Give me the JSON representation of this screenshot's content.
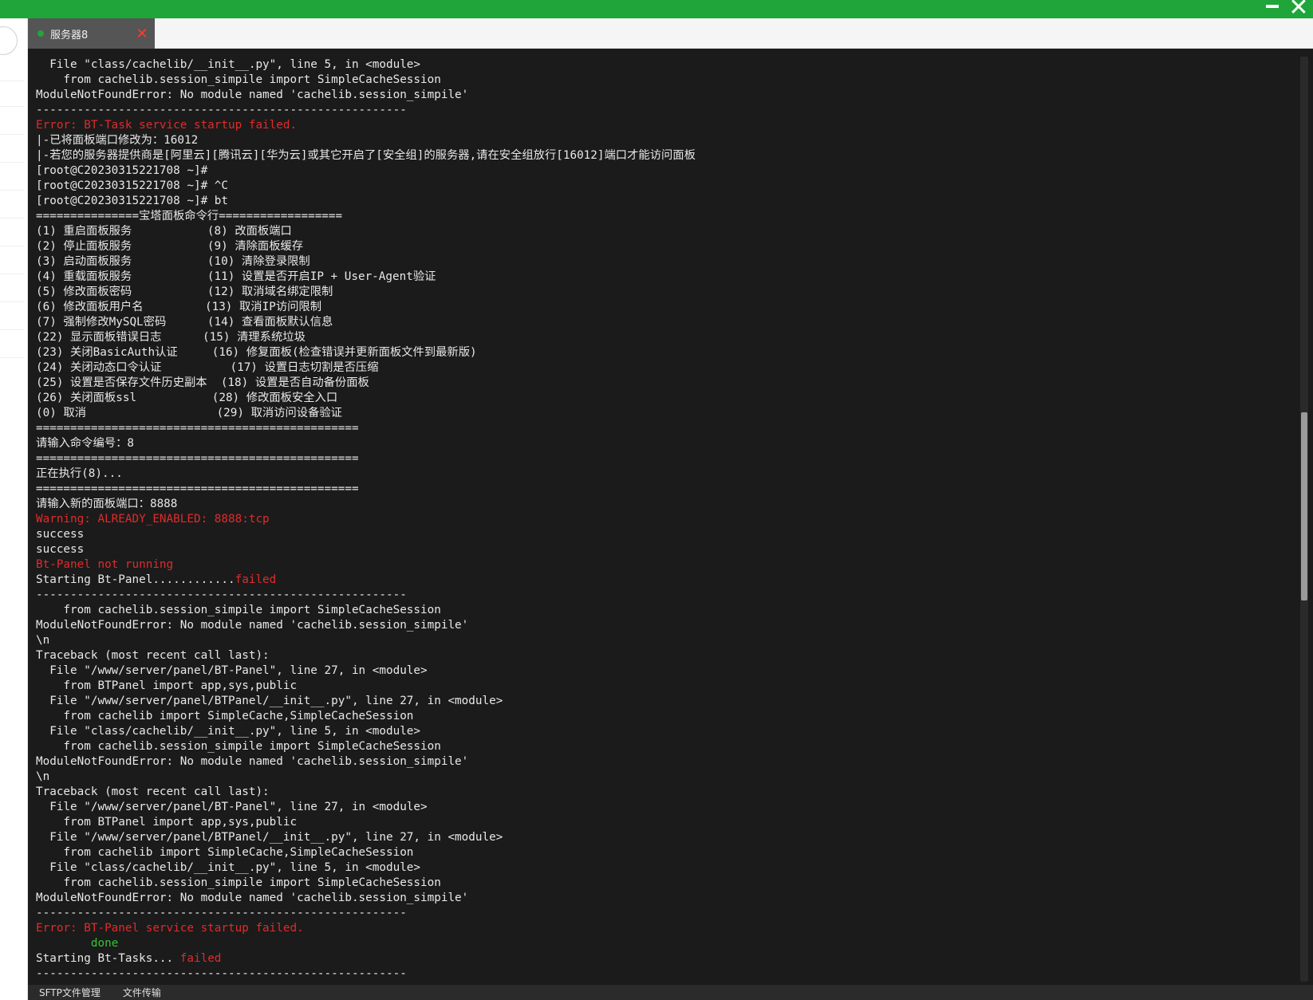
{
  "window": {
    "minimize_icon": "minimize-icon",
    "close_icon": "close-icon",
    "accent": "#20a53a"
  },
  "tabs": [
    {
      "label": "服务器8",
      "status_color": "#20a53a",
      "close_glyph": "✕"
    }
  ],
  "bottom_tabs": [
    {
      "label": "SFTP文件管理"
    },
    {
      "label": "文件传输"
    }
  ],
  "terminal": {
    "background": "#1b1b1b",
    "lines": [
      {
        "segments": [
          {
            "text": "  File \"class/cachelib/__init__.py\", line 5, in <module>"
          }
        ]
      },
      {
        "segments": [
          {
            "text": "    from cachelib.session_simpile import SimpleCacheSession"
          }
        ]
      },
      {
        "segments": [
          {
            "text": "ModuleNotFoundError: No module named 'cachelib.session_simpile'"
          }
        ]
      },
      {
        "segments": [
          {
            "text": "------------------------------------------------------"
          }
        ]
      },
      {
        "segments": [
          {
            "text": "Error: BT-Task service startup failed.",
            "color": "red"
          }
        ]
      },
      {
        "segments": [
          {
            "text": "|-已将面板端口修改为：16012"
          }
        ]
      },
      {
        "segments": [
          {
            "text": "|-若您的服务器提供商是[阿里云][腾讯云][华为云]或其它开启了[安全组]的服务器,请在安全组放行[16012]端口才能访问面板"
          }
        ]
      },
      {
        "segments": [
          {
            "text": "[root@C20230315221708 ~]#"
          }
        ]
      },
      {
        "segments": [
          {
            "text": "[root@C20230315221708 ~]# ^C"
          }
        ]
      },
      {
        "segments": [
          {
            "text": "[root@C20230315221708 ~]# bt"
          }
        ]
      },
      {
        "segments": [
          {
            "text": "===============宝塔面板命令行=================="
          }
        ]
      },
      {
        "segments": [
          {
            "text": "(1) 重启面板服务           (8) 改面板端口"
          }
        ]
      },
      {
        "segments": [
          {
            "text": "(2) 停止面板服务           (9) 清除面板缓存"
          }
        ]
      },
      {
        "segments": [
          {
            "text": "(3) 启动面板服务           (10) 清除登录限制"
          }
        ]
      },
      {
        "segments": [
          {
            "text": "(4) 重载面板服务           (11) 设置是否开启IP + User-Agent验证"
          }
        ]
      },
      {
        "segments": [
          {
            "text": "(5) 修改面板密码           (12) 取消域名绑定限制"
          }
        ]
      },
      {
        "segments": [
          {
            "text": "(6) 修改面板用户名         (13) 取消IP访问限制"
          }
        ]
      },
      {
        "segments": [
          {
            "text": "(7) 强制修改MySQL密码      (14) 查看面板默认信息"
          }
        ]
      },
      {
        "segments": [
          {
            "text": "(22) 显示面板错误日志      (15) 清理系统垃圾"
          }
        ]
      },
      {
        "segments": [
          {
            "text": "(23) 关闭BasicAuth认证     (16) 修复面板(检查错误并更新面板文件到最新版)"
          }
        ]
      },
      {
        "segments": [
          {
            "text": "(24) 关闭动态口令认证          (17) 设置日志切割是否压缩"
          }
        ]
      },
      {
        "segments": [
          {
            "text": "(25) 设置是否保存文件历史副本  (18) 设置是否自动备份面板"
          }
        ]
      },
      {
        "segments": [
          {
            "text": "(26) 关闭面板ssl           (28) 修改面板安全入口"
          }
        ]
      },
      {
        "segments": [
          {
            "text": "(0) 取消                   (29) 取消访问设备验证"
          }
        ]
      },
      {
        "segments": [
          {
            "text": "==============================================="
          }
        ]
      },
      {
        "segments": [
          {
            "text": "请输入命令编号：8"
          }
        ]
      },
      {
        "segments": [
          {
            "text": "==============================================="
          }
        ]
      },
      {
        "segments": [
          {
            "text": "正在执行(8)..."
          }
        ]
      },
      {
        "segments": [
          {
            "text": "==============================================="
          }
        ]
      },
      {
        "segments": [
          {
            "text": "请输入新的面板端口：8888"
          }
        ]
      },
      {
        "segments": [
          {
            "text": "Warning: ALREADY_ENABLED: 8888:tcp",
            "color": "red"
          }
        ]
      },
      {
        "segments": [
          {
            "text": "success"
          }
        ]
      },
      {
        "segments": [
          {
            "text": "success"
          }
        ]
      },
      {
        "segments": [
          {
            "text": "Bt-Panel not running",
            "color": "red"
          }
        ]
      },
      {
        "segments": [
          {
            "text": "Starting Bt-Panel............"
          },
          {
            "text": "failed",
            "color": "red"
          }
        ]
      },
      {
        "segments": [
          {
            "text": "------------------------------------------------------"
          }
        ]
      },
      {
        "segments": [
          {
            "text": "    from cachelib.session_simpile import SimpleCacheSession"
          }
        ]
      },
      {
        "segments": [
          {
            "text": "ModuleNotFoundError: No module named 'cachelib.session_simpile'"
          }
        ]
      },
      {
        "segments": [
          {
            "text": "\\n"
          }
        ]
      },
      {
        "segments": [
          {
            "text": "Traceback (most recent call last):"
          }
        ]
      },
      {
        "segments": [
          {
            "text": "  File \"/www/server/panel/BT-Panel\", line 27, in <module>"
          }
        ]
      },
      {
        "segments": [
          {
            "text": "    from BTPanel import app,sys,public"
          }
        ]
      },
      {
        "segments": [
          {
            "text": "  File \"/www/server/panel/BTPanel/__init__.py\", line 27, in <module>"
          }
        ]
      },
      {
        "segments": [
          {
            "text": "    from cachelib import SimpleCache,SimpleCacheSession"
          }
        ]
      },
      {
        "segments": [
          {
            "text": "  File \"class/cachelib/__init__.py\", line 5, in <module>"
          }
        ]
      },
      {
        "segments": [
          {
            "text": "    from cachelib.session_simpile import SimpleCacheSession"
          }
        ]
      },
      {
        "segments": [
          {
            "text": "ModuleNotFoundError: No module named 'cachelib.session_simpile'"
          }
        ]
      },
      {
        "segments": [
          {
            "text": "\\n"
          }
        ]
      },
      {
        "segments": [
          {
            "text": "Traceback (most recent call last):"
          }
        ]
      },
      {
        "segments": [
          {
            "text": "  File \"/www/server/panel/BT-Panel\", line 27, in <module>"
          }
        ]
      },
      {
        "segments": [
          {
            "text": "    from BTPanel import app,sys,public"
          }
        ]
      },
      {
        "segments": [
          {
            "text": "  File \"/www/server/panel/BTPanel/__init__.py\", line 27, in <module>"
          }
        ]
      },
      {
        "segments": [
          {
            "text": "    from cachelib import SimpleCache,SimpleCacheSession"
          }
        ]
      },
      {
        "segments": [
          {
            "text": "  File \"class/cachelib/__init__.py\", line 5, in <module>"
          }
        ]
      },
      {
        "segments": [
          {
            "text": "    from cachelib.session_simpile import SimpleCacheSession"
          }
        ]
      },
      {
        "segments": [
          {
            "text": "ModuleNotFoundError: No module named 'cachelib.session_simpile'"
          }
        ]
      },
      {
        "segments": [
          {
            "text": "------------------------------------------------------"
          }
        ]
      },
      {
        "segments": [
          {
            "text": "Error: BT-Panel service startup failed.",
            "color": "red"
          }
        ]
      },
      {
        "segments": [
          {
            "text": "        "
          },
          {
            "text": "done",
            "color": "green"
          }
        ]
      },
      {
        "segments": [
          {
            "text": "Starting Bt-Tasks... "
          },
          {
            "text": "failed",
            "color": "red"
          }
        ]
      },
      {
        "segments": [
          {
            "text": "------------------------------------------------------"
          }
        ]
      }
    ]
  }
}
